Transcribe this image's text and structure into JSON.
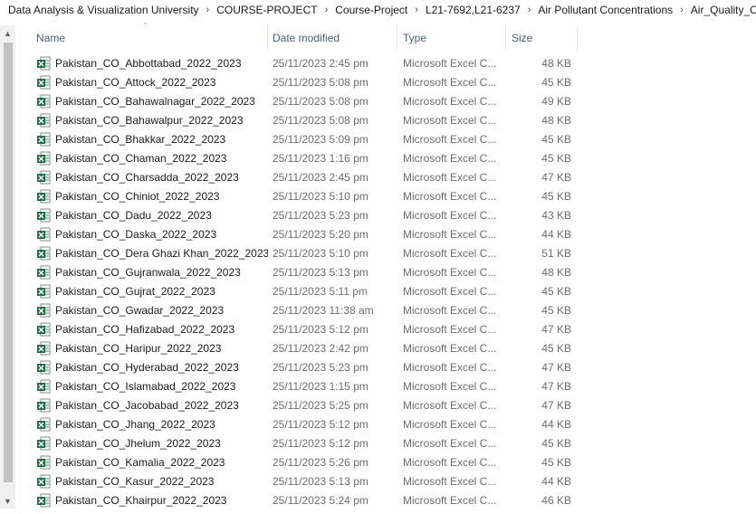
{
  "breadcrumb": [
    "Data Analysis & Visualization University",
    "COURSE-PROJECT",
    "Course-Project",
    "L21-7692,L21-6237",
    "Air Pollutant Concentrations",
    "Air_Quality_CO"
  ],
  "columns": {
    "name": "Name",
    "date_modified": "Date modified",
    "type": "Type",
    "size": "Size"
  },
  "files": [
    {
      "name": "Pakistan_CO_Abbottabad_2022_2023",
      "date": "25/11/2023 2:45 pm",
      "type": "Microsoft Excel C...",
      "size": "48 KB"
    },
    {
      "name": "Pakistan_CO_Attock_2022_2023",
      "date": "25/11/2023 5:08 pm",
      "type": "Microsoft Excel C...",
      "size": "45 KB"
    },
    {
      "name": "Pakistan_CO_Bahawalnagar_2022_2023",
      "date": "25/11/2023 5:08 pm",
      "type": "Microsoft Excel C...",
      "size": "49 KB"
    },
    {
      "name": "Pakistan_CO_Bahawalpur_2022_2023",
      "date": "25/11/2023 5:08 pm",
      "type": "Microsoft Excel C...",
      "size": "48 KB"
    },
    {
      "name": "Pakistan_CO_Bhakkar_2022_2023",
      "date": "25/11/2023 5:09 pm",
      "type": "Microsoft Excel C...",
      "size": "45 KB"
    },
    {
      "name": "Pakistan_CO_Chaman_2022_2023",
      "date": "25/11/2023 1:16 pm",
      "type": "Microsoft Excel C...",
      "size": "45 KB"
    },
    {
      "name": "Pakistan_CO_Charsadda_2022_2023",
      "date": "25/11/2023 2:45 pm",
      "type": "Microsoft Excel C...",
      "size": "47 KB"
    },
    {
      "name": "Pakistan_CO_Chiniot_2022_2023",
      "date": "25/11/2023 5:10 pm",
      "type": "Microsoft Excel C...",
      "size": "45 KB"
    },
    {
      "name": "Pakistan_CO_Dadu_2022_2023",
      "date": "25/11/2023 5:23 pm",
      "type": "Microsoft Excel C...",
      "size": "43 KB"
    },
    {
      "name": "Pakistan_CO_Daska_2022_2023",
      "date": "25/11/2023 5:20 pm",
      "type": "Microsoft Excel C...",
      "size": "44 KB"
    },
    {
      "name": "Pakistan_CO_Dera Ghazi Khan_2022_2023",
      "date": "25/11/2023 5:10 pm",
      "type": "Microsoft Excel C...",
      "size": "51 KB"
    },
    {
      "name": "Pakistan_CO_Gujranwala_2022_2023",
      "date": "25/11/2023 5:13 pm",
      "type": "Microsoft Excel C...",
      "size": "48 KB"
    },
    {
      "name": "Pakistan_CO_Gujrat_2022_2023",
      "date": "25/11/2023 5:11 pm",
      "type": "Microsoft Excel C...",
      "size": "45 KB"
    },
    {
      "name": "Pakistan_CO_Gwadar_2022_2023",
      "date": "25/11/2023 11:38 am",
      "type": "Microsoft Excel C...",
      "size": "45 KB"
    },
    {
      "name": "Pakistan_CO_Hafizabad_2022_2023",
      "date": "25/11/2023 5:12 pm",
      "type": "Microsoft Excel C...",
      "size": "47 KB"
    },
    {
      "name": "Pakistan_CO_Haripur_2022_2023",
      "date": "25/11/2023 2:42 pm",
      "type": "Microsoft Excel C...",
      "size": "45 KB"
    },
    {
      "name": "Pakistan_CO_Hyderabad_2022_2023",
      "date": "25/11/2023 5:23 pm",
      "type": "Microsoft Excel C...",
      "size": "47 KB"
    },
    {
      "name": "Pakistan_CO_Islamabad_2022_2023",
      "date": "25/11/2023 1:15 pm",
      "type": "Microsoft Excel C...",
      "size": "47 KB"
    },
    {
      "name": "Pakistan_CO_Jacobabad_2022_2023",
      "date": "25/11/2023 5:25 pm",
      "type": "Microsoft Excel C...",
      "size": "47 KB"
    },
    {
      "name": "Pakistan_CO_Jhang_2022_2023",
      "date": "25/11/2023 5:12 pm",
      "type": "Microsoft Excel C...",
      "size": "44 KB"
    },
    {
      "name": "Pakistan_CO_Jhelum_2022_2023",
      "date": "25/11/2023 5:12 pm",
      "type": "Microsoft Excel C...",
      "size": "45 KB"
    },
    {
      "name": "Pakistan_CO_Kamalia_2022_2023",
      "date": "25/11/2023 5:26 pm",
      "type": "Microsoft Excel C...",
      "size": "45 KB"
    },
    {
      "name": "Pakistan_CO_Kasur_2022_2023",
      "date": "25/11/2023 5:13 pm",
      "type": "Microsoft Excel C...",
      "size": "44 KB"
    },
    {
      "name": "Pakistan_CO_Khairpur_2022_2023",
      "date": "25/11/2023 5:24 pm",
      "type": "Microsoft Excel C...",
      "size": "46 KB"
    }
  ],
  "icons": {
    "file_icon": "excel-csv-icon",
    "sort": "sort-up-icon",
    "scroll_up": "scroll-up-arrow-icon",
    "scroll_down": "scroll-down-arrow-icon",
    "separator": "chevron-right-icon"
  },
  "colors": {
    "excel_green": "#1d7044",
    "header_text": "#4c607a",
    "secondary_text": "#6d6d6d"
  }
}
